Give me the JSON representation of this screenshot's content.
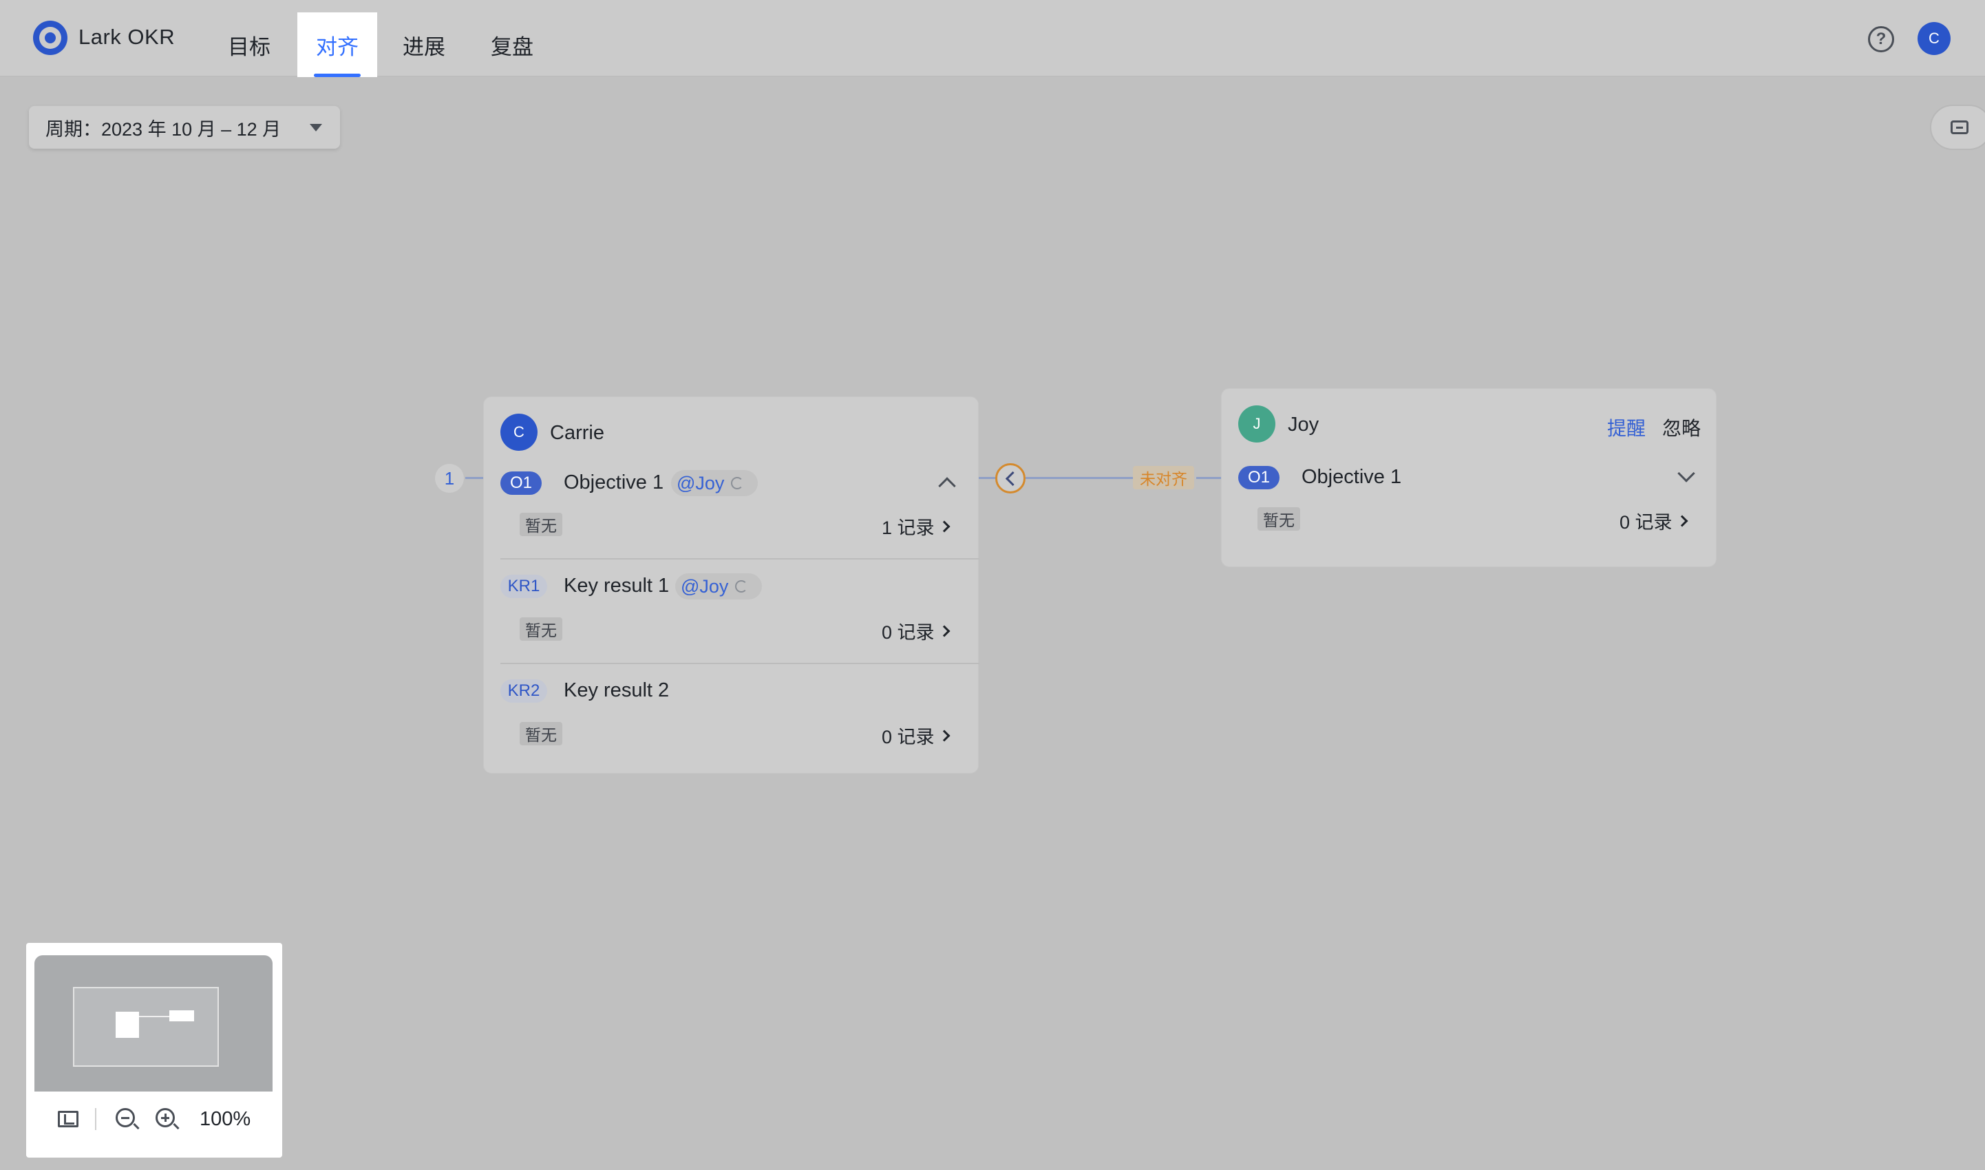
{
  "header": {
    "brand": "Lark OKR",
    "tabs": [
      {
        "label": "目标"
      },
      {
        "label": "对齐"
      },
      {
        "label": "进展"
      },
      {
        "label": "复盘"
      }
    ],
    "active_tab": "对齐",
    "help_icon": "?",
    "user_initial": "C"
  },
  "toolbar": {
    "period_label": "周期：2023 年 10 月 – 12 月"
  },
  "left_card": {
    "owner_initial": "C",
    "owner_name": "Carrie",
    "incoming_count": "1",
    "objective": {
      "badge": "O1",
      "title": "Objective 1",
      "mention": "@Joy",
      "status_tag": "暂无",
      "records": "1 记录"
    },
    "key_results": [
      {
        "badge": "KR1",
        "title": "Key result 1",
        "mention": "@Joy",
        "status_tag": "暂无",
        "records": "0 记录"
      },
      {
        "badge": "KR2",
        "title": "Key result 2",
        "status_tag": "暂无",
        "records": "0 记录"
      }
    ]
  },
  "connector": {
    "status_label": "未对齐",
    "status_color": "#d7862a"
  },
  "right_card": {
    "owner_initial": "J",
    "owner_name": "Joy",
    "remind_label": "提醒",
    "ignore_label": "忽略",
    "objective": {
      "badge": "O1",
      "title": "Objective 1",
      "status_tag": "暂无",
      "records": "0 记录"
    }
  },
  "minimap": {
    "zoom_level": "100%"
  },
  "colors": {
    "accent": "#3370ff",
    "objective_badge": "#3f61c8",
    "joy_avatar": "#45a58a"
  }
}
